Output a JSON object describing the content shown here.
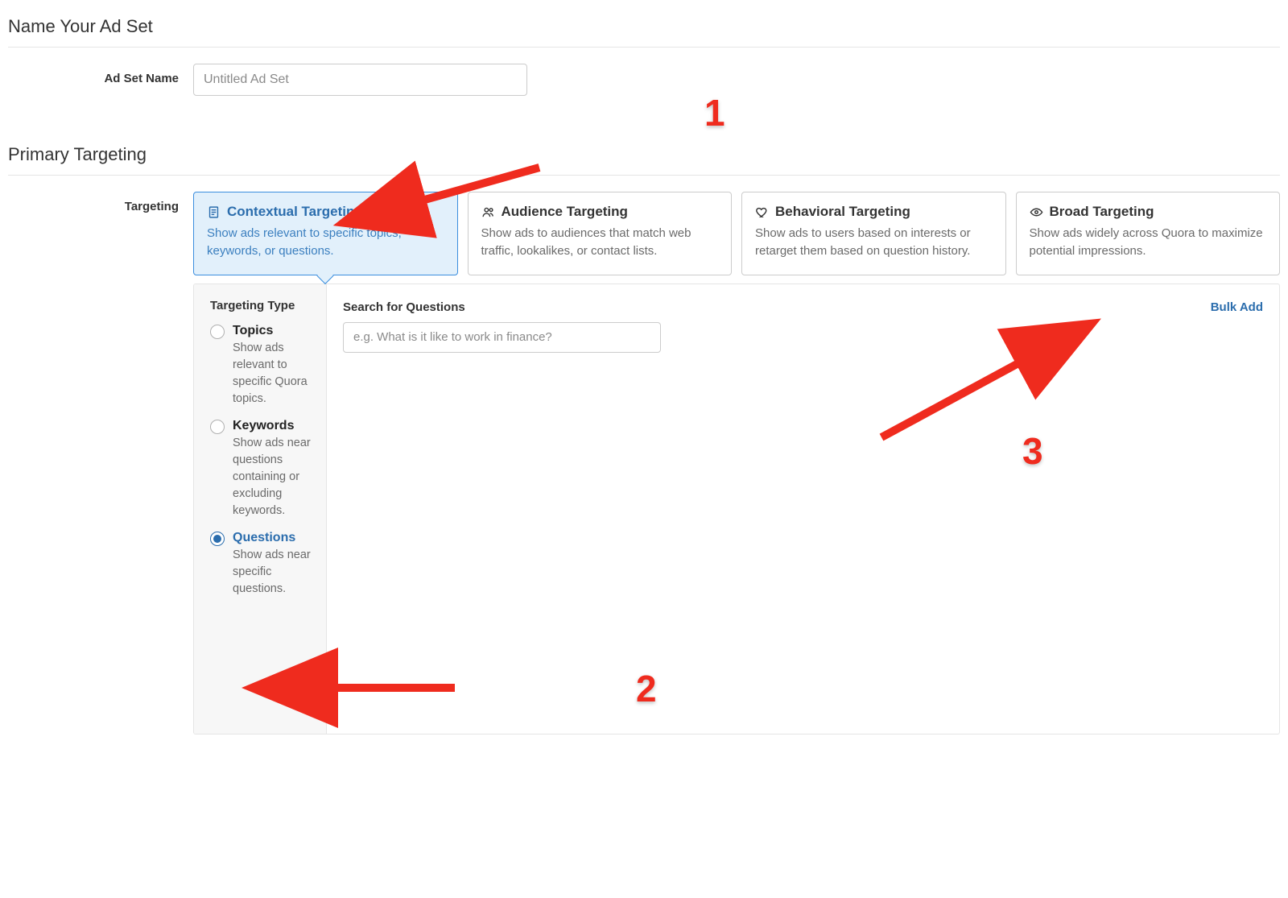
{
  "section1": {
    "title": "Name Your Ad Set"
  },
  "adset_name": {
    "label": "Ad Set Name",
    "placeholder": "Untitled Ad Set",
    "value": ""
  },
  "section2": {
    "title": "Primary Targeting"
  },
  "targeting": {
    "label": "Targeting",
    "cards": [
      {
        "title": "Contextual Targeting",
        "desc": "Show ads relevant to specific topics, keywords, or questions.",
        "selected": true
      },
      {
        "title": "Audience Targeting",
        "desc": "Show ads to audiences that match web traffic, lookalikes, or contact lists.",
        "selected": false
      },
      {
        "title": "Behavioral Targeting",
        "desc": "Show ads to users based on interests or retarget them based on question history.",
        "selected": false
      },
      {
        "title": "Broad Targeting",
        "desc": "Show ads widely across Quora to maximize potential impressions.",
        "selected": false
      }
    ]
  },
  "targeting_type": {
    "title": "Targeting Type",
    "options": [
      {
        "label": "Topics",
        "desc": "Show ads relevant to specific Quora topics.",
        "checked": false
      },
      {
        "label": "Keywords",
        "desc": "Show ads near questions containing or excluding keywords.",
        "checked": false
      },
      {
        "label": "Questions",
        "desc": "Show ads near specific questions.",
        "checked": true
      }
    ]
  },
  "search": {
    "title": "Search for Questions",
    "placeholder": "e.g. What is it like to work in finance?",
    "bulk_add": "Bulk Add"
  },
  "annotations": {
    "n1": "1",
    "n2": "2",
    "n3": "3"
  }
}
